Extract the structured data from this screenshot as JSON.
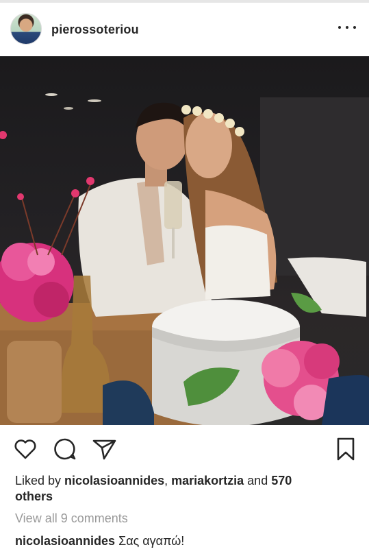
{
  "post": {
    "username": "pierossoteriou",
    "likes": {
      "prefix": "Liked by ",
      "user1": "nicolasioannides",
      "separator": ", ",
      "user2": "mariakortzia",
      "conjunction": " and ",
      "count": "570",
      "suffix": "others"
    },
    "view_comments": "View all 9 comments",
    "comment": {
      "author": "nicolasioannides",
      "text": "Σας αγαπώ!"
    }
  },
  "icons": {
    "more": "more-options-icon",
    "like": "heart-icon",
    "comment": "comment-icon",
    "share": "send-icon",
    "save": "bookmark-icon"
  },
  "colors": {
    "text": "#262626",
    "muted": "#999999",
    "border": "#dbdbdb"
  }
}
